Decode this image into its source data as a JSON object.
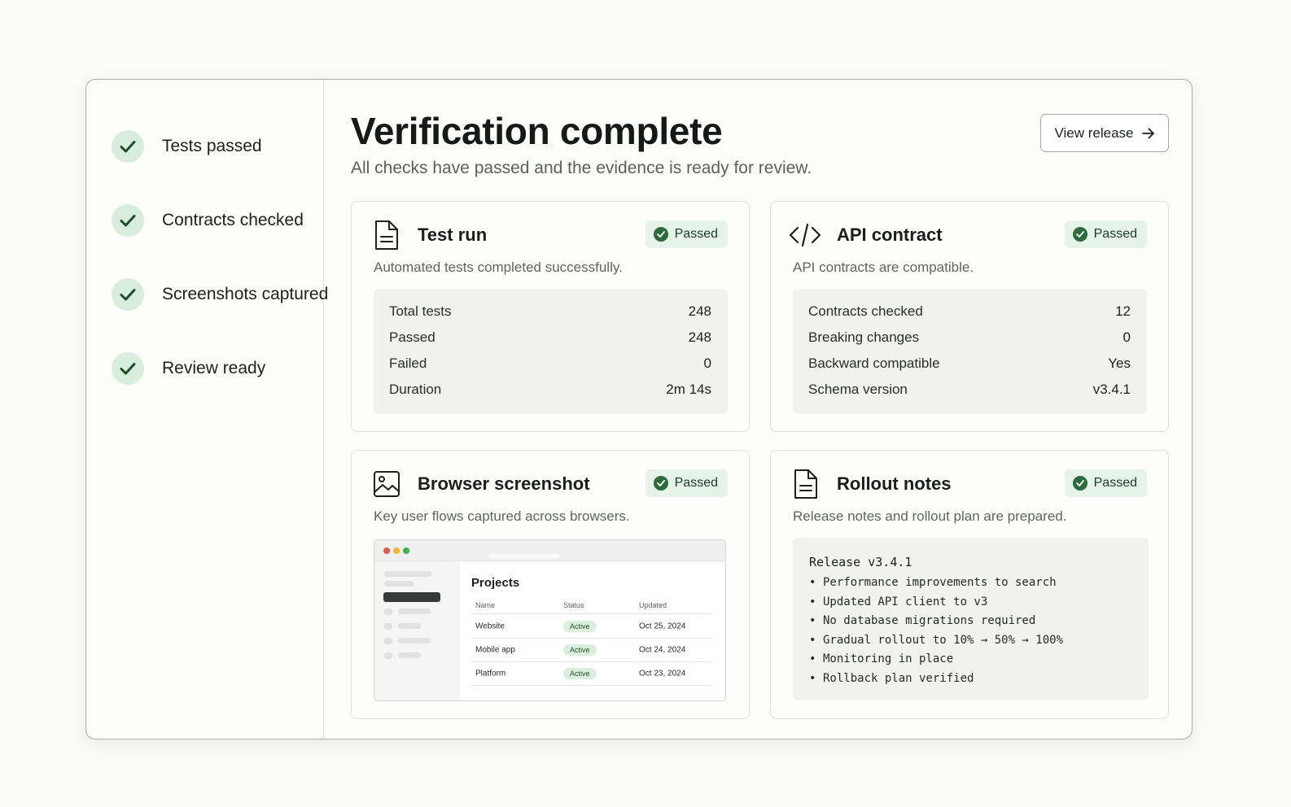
{
  "sidebar": {
    "steps": [
      {
        "label": "Tests passed"
      },
      {
        "label": "Contracts checked"
      },
      {
        "label": "Screenshots captured"
      },
      {
        "label": "Review ready"
      }
    ]
  },
  "header": {
    "title": "Verification complete",
    "subtitle": "All checks have passed and the evidence is ready for review.",
    "view_release_label": "View release"
  },
  "cards": {
    "test_run": {
      "title": "Test run",
      "badge": "Passed",
      "description": "Automated tests completed successfully.",
      "stats": [
        {
          "label": "Total tests",
          "value": "248"
        },
        {
          "label": "Passed",
          "value": "248"
        },
        {
          "label": "Failed",
          "value": "0"
        },
        {
          "label": "Duration",
          "value": "2m 14s"
        }
      ]
    },
    "api_contract": {
      "title": "API contract",
      "badge": "Passed",
      "description": "API contracts are compatible.",
      "stats": [
        {
          "label": "Contracts checked",
          "value": "12"
        },
        {
          "label": "Breaking changes",
          "value": "0"
        },
        {
          "label": "Backward compatible",
          "value": "Yes"
        },
        {
          "label": "Schema version",
          "value": "v3.4.1"
        }
      ]
    },
    "browser_screenshot": {
      "title": "Browser screenshot",
      "badge": "Passed",
      "description": "Key user flows captured across browsers.",
      "preview": {
        "heading": "Projects",
        "columns": [
          "Name",
          "Status",
          "Updated"
        ],
        "rows": [
          {
            "name": "Website",
            "status": "Active",
            "updated": "Oct 25, 2024"
          },
          {
            "name": "Mobile app",
            "status": "Active",
            "updated": "Oct 24, 2024"
          },
          {
            "name": "Platform",
            "status": "Active",
            "updated": "Oct 23, 2024"
          }
        ]
      }
    },
    "rollout_notes": {
      "title": "Rollout notes",
      "badge": "Passed",
      "description": "Release notes and rollout plan are prepared.",
      "notes_title": "Release v3.4.1",
      "bullet": "•",
      "notes": [
        "Performance improvements to search",
        "Updated API client to v3",
        "No database migrations required",
        "Gradual rollout to 10% → 50% → 100%",
        "Monitoring in place",
        "Rollback plan verified"
      ]
    }
  },
  "colors": {
    "accent_green": "#2d6b3e",
    "badge_bg": "#e6f3e8",
    "check_bg": "#d9eddd"
  }
}
